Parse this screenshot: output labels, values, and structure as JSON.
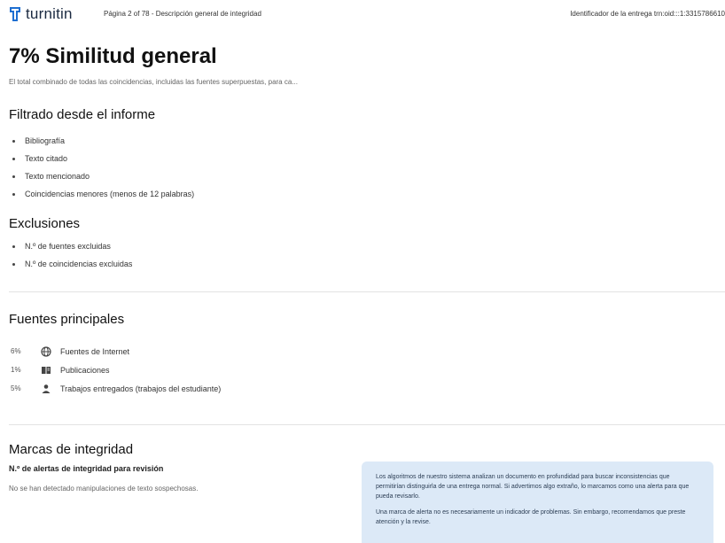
{
  "header": {
    "logo_text": "turnitin",
    "page_info": "Página 2 of 78 - Descripción general de integridad",
    "submission_id": "Identificador de la entrega trn:oid:::1:3315786610"
  },
  "title": "7% Similitud general",
  "subtitle": "El total combinado de todas las coincidencias, incluidas las fuentes superpuestas, para ca...",
  "filtered": {
    "heading": "Filtrado desde el informe",
    "items": [
      "Bibliografía",
      "Texto citado",
      "Texto mencionado",
      "Coincidencias menores (menos de 12 palabras)"
    ]
  },
  "exclusions": {
    "heading": "Exclusiones",
    "items": [
      "N.º de fuentes excluidas",
      "N.º de coincidencias excluidas"
    ]
  },
  "sources": {
    "heading": "Fuentes principales",
    "items": [
      {
        "pct": "6%",
        "icon": "globe-icon",
        "label": "Fuentes de Internet"
      },
      {
        "pct": "1%",
        "icon": "book-icon",
        "label": "Publicaciones"
      },
      {
        "pct": "5%",
        "icon": "person-icon",
        "label": "Trabajos entregados (trabajos del estudiante)"
      }
    ]
  },
  "integrity": {
    "heading": "Marcas de integridad",
    "alerts_label": "N.º de alertas de integridad para revisión",
    "alerts_text": "No se han detectado manipulaciones de texto sospechosas.",
    "info_p1": "Los algoritmos de nuestro sistema analizan un documento en profundidad para buscar inconsistencias que permitirían distinguirla de una entrega normal. Si advertimos algo extraño, lo marcamos como una alerta para que pueda revisarlo.",
    "info_p2": "Una marca de alerta no es necesariamente un indicador de problemas. Sin embargo, recomendamos que preste atención y la revise."
  },
  "colors": {
    "logo_blue": "#1f6fd1",
    "info_box_bg": "#dce9f7",
    "divider": "#e3e3e3"
  }
}
